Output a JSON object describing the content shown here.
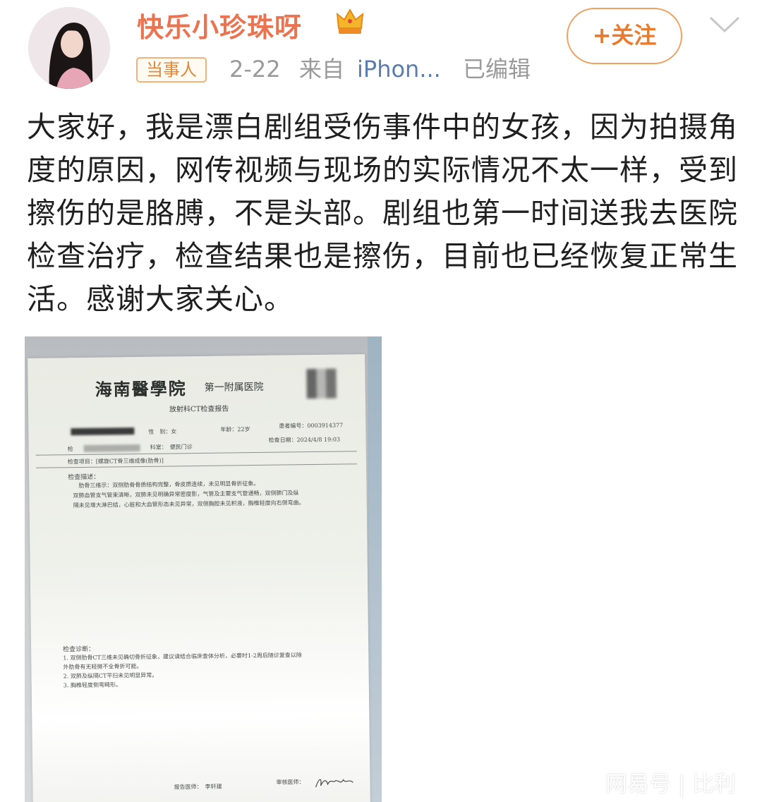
{
  "header": {
    "username": "快乐小珍珠呀",
    "badge": "当事人",
    "date": "2-22",
    "source_prefix": "来自",
    "source_device": "iPhon...",
    "edited": "已编辑",
    "follow_label": "+关注"
  },
  "post": {
    "text": "大家好，我是漂白剧组受伤事件中的女孩，因为拍摄角度的原因，网传视频与现场的实际情况不太一样，受到擦伤的是胳膊，不是头部。剧组也第一时间送我去医院检查治疗，检查结果也是擦伤，目前也已经恢复正常生活。感谢大家关心。"
  },
  "document": {
    "hospital": "海南醫學院",
    "hospital_sub": "第一附属医院",
    "report_title": "放射科CT检查报告",
    "gender_label": "性　别：女",
    "age_label": "年龄：22岁",
    "patient_no": "患者编号：0003914377",
    "exam_label": "检",
    "dept_label": "科室：　便民门诊",
    "exam_date": "检查日期：2024/4/8 19:03",
    "exam_item": "检查项目：[螺旋CT骨三维成像(肋骨)]",
    "desc_title": "检查描述：",
    "desc_lines": [
      "肋骨三维示：双侧肋骨骨质结构完整，骨皮质连续，未见明显骨折征象。",
      "双肺血管支气管束清晰，双肺未见明确异常密度影，气管及主要支气管通畅，双侧肺门及纵",
      "隔未见增大淋巴结，心脏和大血管形态未见异常，双侧胸腔未见积液，胸椎轻度向右侧弯曲。"
    ],
    "diag_title": "检查诊断：",
    "diag_lines": [
      "1. 双侧肋骨CT三维未见确切骨折征象，建议请结合临床查体分析，必要时1-2周后随诊复查以除",
      "外肋骨有无轻微不全骨折可能。",
      "2. 双肺及纵隔CT平扫未见明显异常。",
      "3. 胸椎轻度侧弯畸形。"
    ],
    "doctor": "报告医师：　李轩建",
    "reviewer": "审核医师："
  },
  "watermark": {
    "brand": "网易号",
    "separator": "|",
    "author": "比利"
  }
}
